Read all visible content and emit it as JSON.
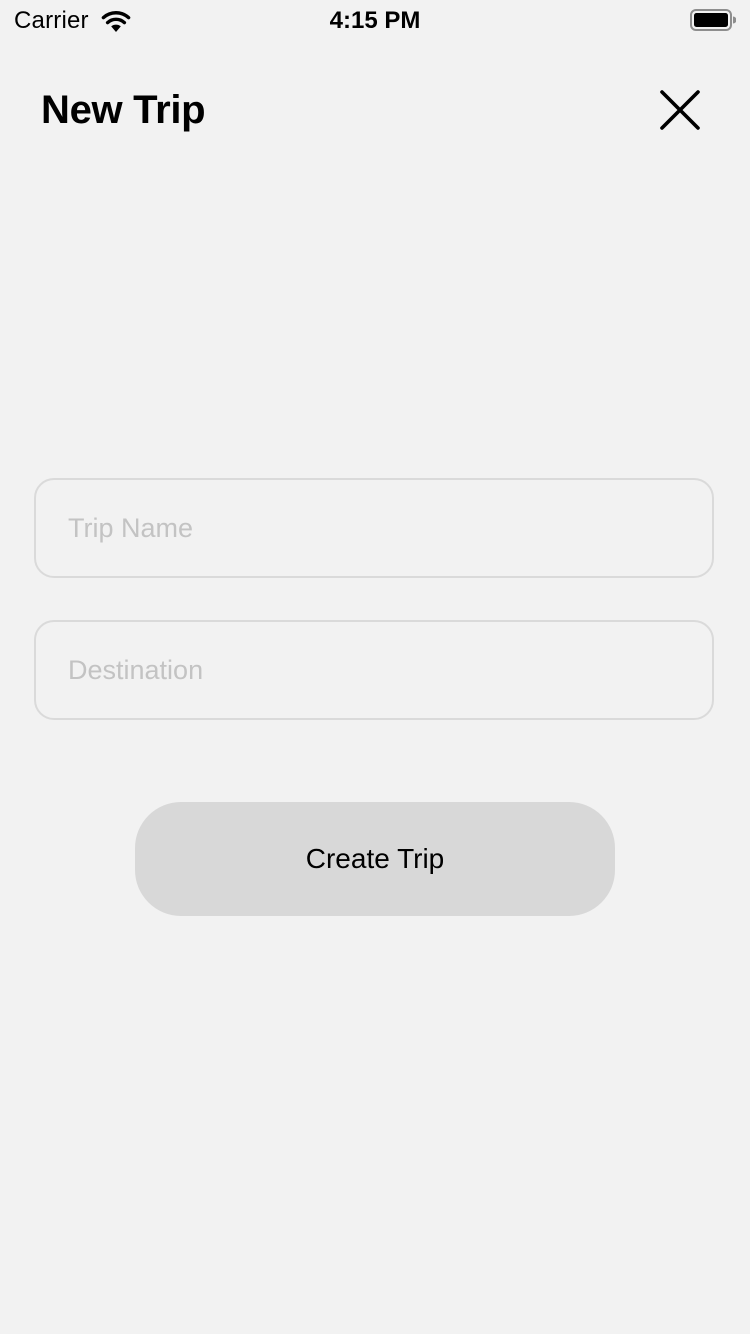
{
  "status_bar": {
    "carrier": "Carrier",
    "time": "4:15 PM",
    "wifi_icon": "wifi-icon",
    "battery_icon": "battery-full-icon"
  },
  "header": {
    "title": "New Trip",
    "close_icon": "close-icon"
  },
  "form": {
    "trip_name": {
      "value": "",
      "placeholder": "Trip Name"
    },
    "destination": {
      "value": "",
      "placeholder": "Destination"
    },
    "submit_label": "Create Trip"
  },
  "colors": {
    "background": "#f2f2f2",
    "field_border": "#dadada",
    "placeholder": "#c3c3c3",
    "button_background": "#d8d8d8",
    "text": "#000000"
  }
}
